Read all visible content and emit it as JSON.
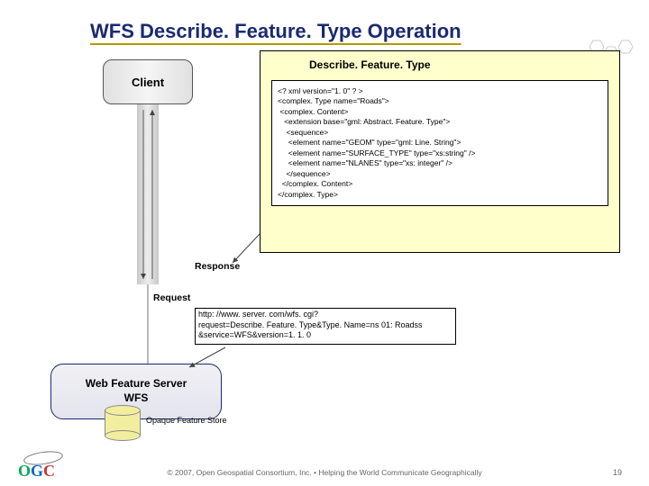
{
  "title": "WFS Describe. Feature. Type Operation",
  "client_label": "Client",
  "xml_title": "Describe. Feature. Type",
  "xml_body": "<? xml version=\"1. 0\" ? >\n<complex. Type name=\"Roads\">\n <complex. Content>\n   <extension base=\"gml: Abstract. Feature. Type\">\n    <sequence>\n     <element name=\"GEOM\" type=\"gml: Line. String\">\n     <element name=\"SURFACE_TYPE\" type=\"xs:string\" />\n     <element name=\"NLANES\" type=\"xs: integer\" />\n    </sequence>\n  </complex. Content>\n</complex. Type>",
  "response_label": "Response",
  "request_label": "Request",
  "url_line1": "http: //www. server. com/wfs. cgi?",
  "url_line2": " request=Describe. Feature. Type&Type. Name=ns 01: Roadss",
  "url_line3": " &service=WFS&version=1. 1. 0",
  "wfs_line1": "Web Feature Server",
  "wfs_line2": "WFS",
  "store_label": "Opaque Feature Store",
  "footer": "© 2007, Open Geospatial Consortium, Inc. • Helping the World Communicate Geographically",
  "page_number": "19",
  "logo": {
    "o": "O",
    "g": "G",
    "c": "C"
  }
}
